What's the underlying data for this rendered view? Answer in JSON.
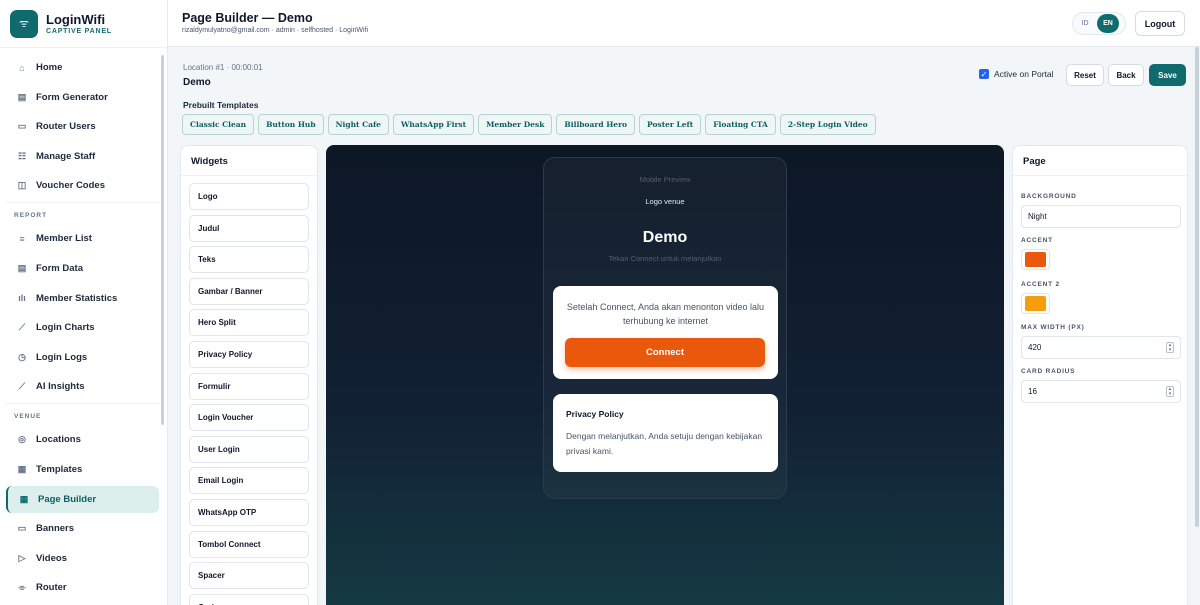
{
  "brand": {
    "name": "LoginWifi",
    "subtitle": "CAPTIVE PANEL"
  },
  "sidebar": {
    "items_main": [
      {
        "label": "Home",
        "icon": "home-icon",
        "glyph": "⌂"
      },
      {
        "label": "Form Generator",
        "icon": "form-icon",
        "glyph": "▤"
      },
      {
        "label": "Router Users",
        "icon": "users-icon",
        "glyph": "▭"
      },
      {
        "label": "Manage Staff",
        "icon": "staff-icon",
        "glyph": "☷"
      },
      {
        "label": "Voucher Codes",
        "icon": "voucher-icon",
        "glyph": "◫"
      }
    ],
    "section_report": "REPORT",
    "items_report": [
      {
        "label": "Member List",
        "icon": "list-icon",
        "glyph": "≡"
      },
      {
        "label": "Form Data",
        "icon": "file-icon",
        "glyph": "▤"
      },
      {
        "label": "Member Statistics",
        "icon": "bar-chart-icon",
        "glyph": "ılı"
      },
      {
        "label": "Login Charts",
        "icon": "line-chart-icon",
        "glyph": "⟋"
      },
      {
        "label": "Login Logs",
        "icon": "clock-icon",
        "glyph": "◷"
      },
      {
        "label": "AI Insights",
        "icon": "trend-icon",
        "glyph": "⟋"
      }
    ],
    "section_venue": "VENUE",
    "items_venue": [
      {
        "label": "Locations",
        "icon": "pin-icon",
        "glyph": "◎"
      },
      {
        "label": "Templates",
        "icon": "grid-icon",
        "glyph": "▦"
      },
      {
        "label": "Page Builder",
        "icon": "layout-icon",
        "glyph": "▦",
        "active": true
      },
      {
        "label": "Banners",
        "icon": "banner-icon",
        "glyph": "▭"
      },
      {
        "label": "Videos",
        "icon": "video-icon",
        "glyph": "▷"
      },
      {
        "label": "Router",
        "icon": "router-icon",
        "glyph": "⌯"
      }
    ]
  },
  "header": {
    "title": "Page Builder — Demo",
    "meta": "rizaldymulyatno@gmail.com · admin · selfhosted · LoginWifi",
    "lang_id": "ID",
    "lang_en": "EN",
    "logout": "Logout"
  },
  "location": {
    "line": "Location #1 · 00:00:01",
    "name": "Demo"
  },
  "actions": {
    "active_portal": "Active on Portal",
    "reset": "Reset",
    "back": "Back",
    "save": "Save"
  },
  "prebuilt": {
    "label": "Prebuilt Templates",
    "templates": [
      "Classic Clean",
      "Button Hub",
      "Night Cafe",
      "WhatsApp First",
      "Member Desk",
      "Billboard Hero",
      "Poster Left",
      "Floating CTA",
      "2-Step Login Video"
    ]
  },
  "widgets": {
    "title": "Widgets",
    "items": [
      "Logo",
      "Judul",
      "Teks",
      "Gambar / Banner",
      "Hero Split",
      "Privacy Policy",
      "Formulir",
      "Login Voucher",
      "User Login",
      "Email Login",
      "WhatsApp OTP",
      "Tombol Connect",
      "Spacer",
      "Garis"
    ]
  },
  "preview": {
    "mobile_label": "Mobile Preview",
    "logo": "Logo venue",
    "title": "Demo",
    "subtitle": "Tekan Connect untuk melanjutkan",
    "card_text": "Setelah Connect, Anda akan menonton video lalu terhubung ke internet",
    "connect": "Connect",
    "privacy_title": "Privacy Policy",
    "privacy_text": "Dengan melanjutkan, Anda setuju dengan kebijakan privasi kami."
  },
  "page_panel": {
    "title": "Page",
    "background_label": "BACKGROUND",
    "background_value": "Night",
    "accent_label": "ACCENT",
    "accent_color": "#ea580c",
    "accent2_label": "ACCENT 2",
    "accent2_color": "#f59e0b",
    "max_width_label": "MAX WIDTH (PX)",
    "max_width_value": "420",
    "radius_label": "CARD RADIUS",
    "radius_value": "16"
  },
  "colors": {
    "primary": "#0f6b6e",
    "accent": "#ea580c"
  }
}
